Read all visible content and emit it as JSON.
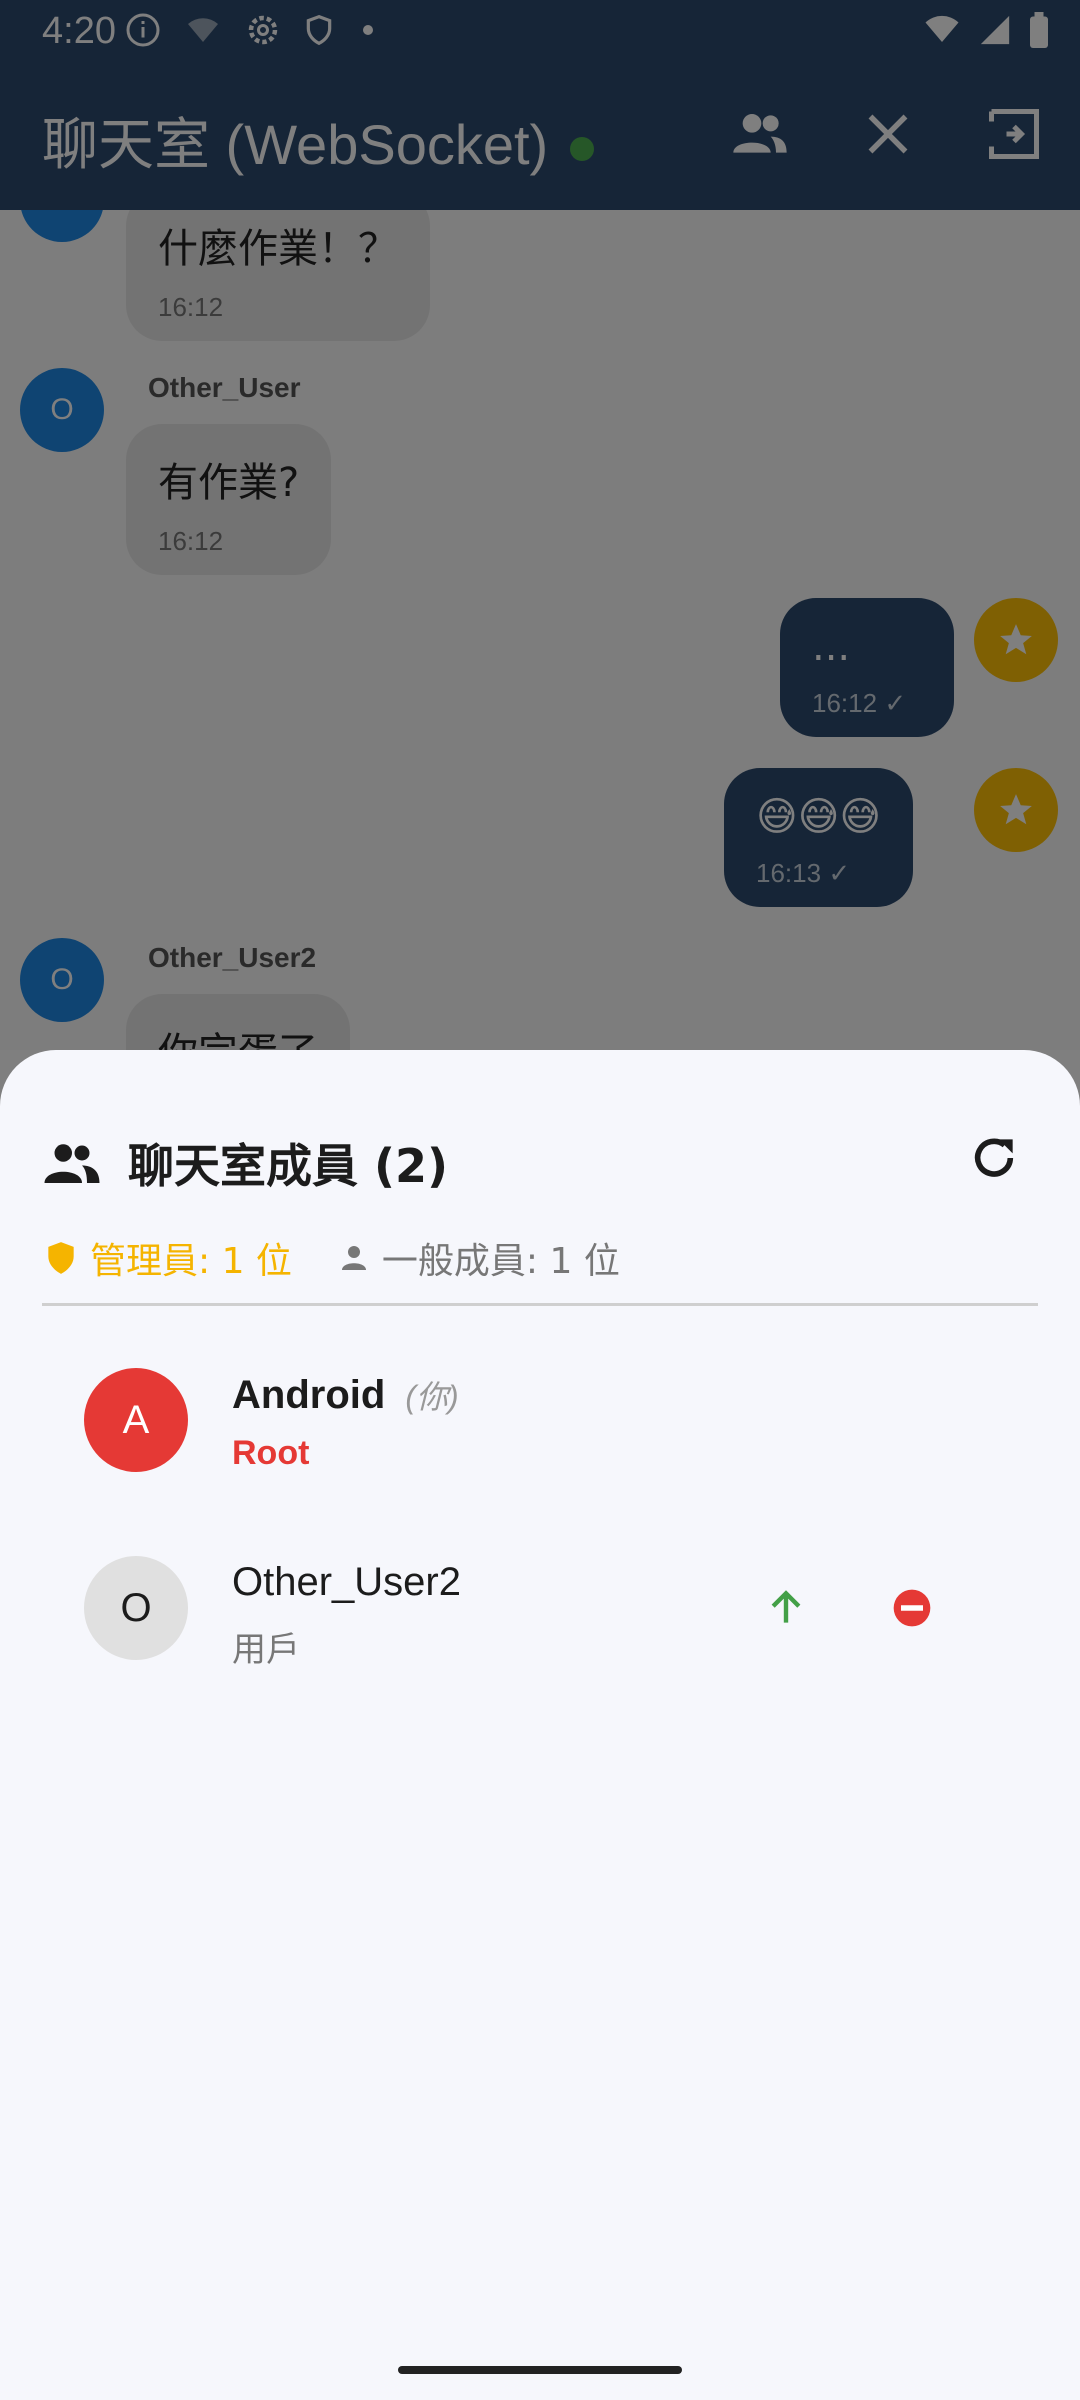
{
  "status_bar": {
    "time": "4:20"
  },
  "app_bar": {
    "title": "聊天室 (WebSocket)"
  },
  "messages": [
    {
      "text": "什麼作業！？",
      "time": "16:12"
    },
    {
      "user": "Other_User",
      "avatar": "O",
      "text": "有作業?",
      "time": "16:12"
    },
    {
      "text": "...",
      "time": "16:12"
    },
    {
      "text": "😅😅😅",
      "time": "16:13"
    },
    {
      "user": "Other_User2",
      "avatar": "O",
      "text": "你完蛋了"
    }
  ],
  "members_sheet": {
    "title": "聊天室成員 (2)",
    "admin_count": "管理員: 1 位",
    "member_count": "一般成員: 1 位",
    "members": [
      {
        "avatar": "A",
        "name": "Android",
        "you_tag": "(你)",
        "role": "Root"
      },
      {
        "avatar": "O",
        "name": "Other_User2",
        "role": "用戶"
      }
    ]
  },
  "colors": {
    "primary": "#2c4a6e",
    "online": "#4caf50",
    "admin": "#f5b400",
    "root": "#e53935",
    "promote": "#43a047",
    "remove": "#e53935"
  }
}
